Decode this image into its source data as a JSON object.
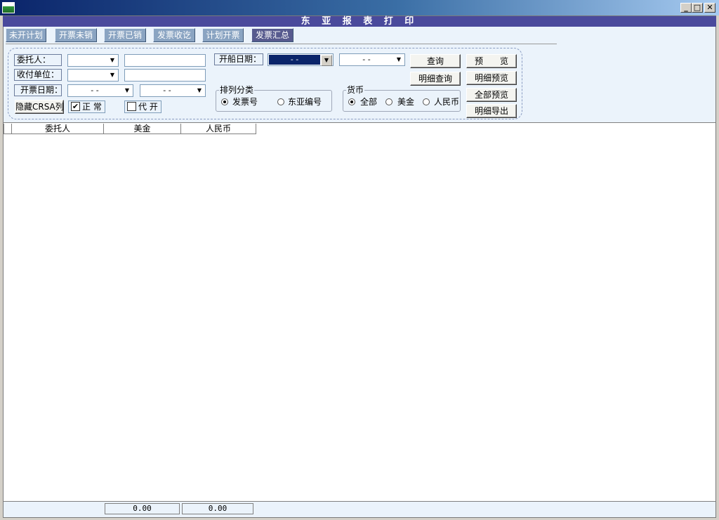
{
  "window": {
    "min_label": "_",
    "max_label": "□",
    "close_label": "✕"
  },
  "report_title": "东 亚 报 表 打 印",
  "tabs": [
    {
      "label": "未开计划"
    },
    {
      "label": "开票未销"
    },
    {
      "label": "开票已销"
    },
    {
      "label": "发票收讫"
    },
    {
      "label": "计划开票"
    },
    {
      "label": "发票汇总",
      "active": true
    }
  ],
  "filters": {
    "client_label": "委托人：",
    "payee_label": "收付单位：",
    "invoice_date_label": "开票日期：",
    "sail_date_label": "开船日期：",
    "date_placeholder": "-  -",
    "combo_arrow": "▼",
    "hide_button": "隐藏CRSA列",
    "normal_label": "正 常",
    "normal_checked": true,
    "proxy_label": "代 开",
    "proxy_checked": false
  },
  "sort_group": {
    "title": "排列分类",
    "options": [
      {
        "label": "发票号",
        "selected": true
      },
      {
        "label": "东亚编号",
        "selected": false
      }
    ]
  },
  "currency_group": {
    "title": "货币",
    "options": [
      {
        "label": "全部",
        "selected": true
      },
      {
        "label": "美金",
        "selected": false
      },
      {
        "label": "人民币",
        "selected": false
      }
    ]
  },
  "buttons": {
    "query": "查询",
    "preview": "预　　览",
    "detail_query": "明细查询",
    "detail_preview": "明细预览",
    "full_preview": "全部预览",
    "detail_export": "明细导出"
  },
  "grid": {
    "columns": [
      "委托人",
      "美金",
      "人民币"
    ],
    "totals": {
      "usd": "0.00",
      "rmb": "0.00"
    }
  }
}
